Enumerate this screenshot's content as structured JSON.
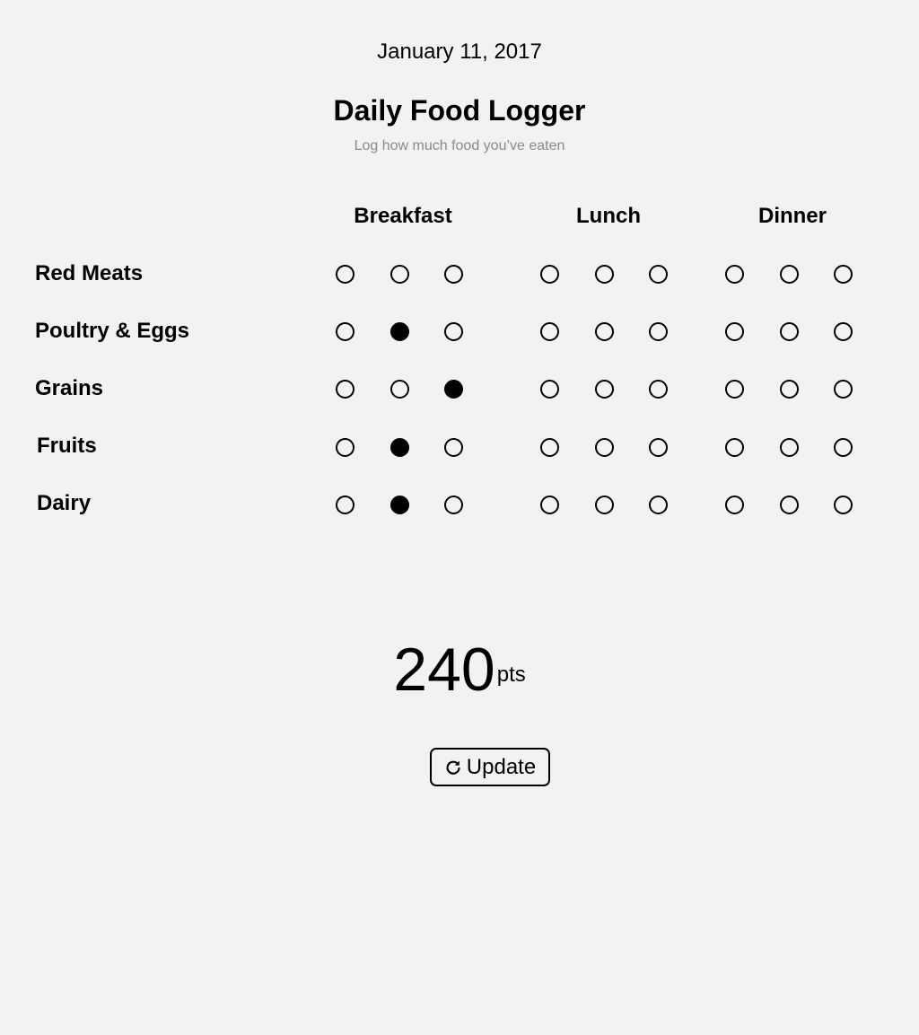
{
  "header": {
    "date": "January 11, 2017",
    "title": "Daily Food Logger",
    "subtitle": "Log how much food you’ve eaten"
  },
  "meals": [
    "Breakfast",
    "Lunch",
    "Dinner"
  ],
  "foods": [
    {
      "label": "Red Meats",
      "selections": [
        null,
        null,
        null
      ]
    },
    {
      "label": "Poultry & Eggs",
      "selections": [
        2,
        null,
        null
      ]
    },
    {
      "label": "Grains",
      "selections": [
        3,
        null,
        null
      ]
    },
    {
      "label": "Fruits",
      "selections": [
        2,
        null,
        null
      ]
    },
    {
      "label": "Dairy",
      "selections": [
        2,
        null,
        null
      ]
    }
  ],
  "levels_per_meal": 3,
  "score": {
    "value": "240",
    "unit": "pts"
  },
  "update_button": {
    "label": "Update",
    "icon": "refresh-icon"
  }
}
